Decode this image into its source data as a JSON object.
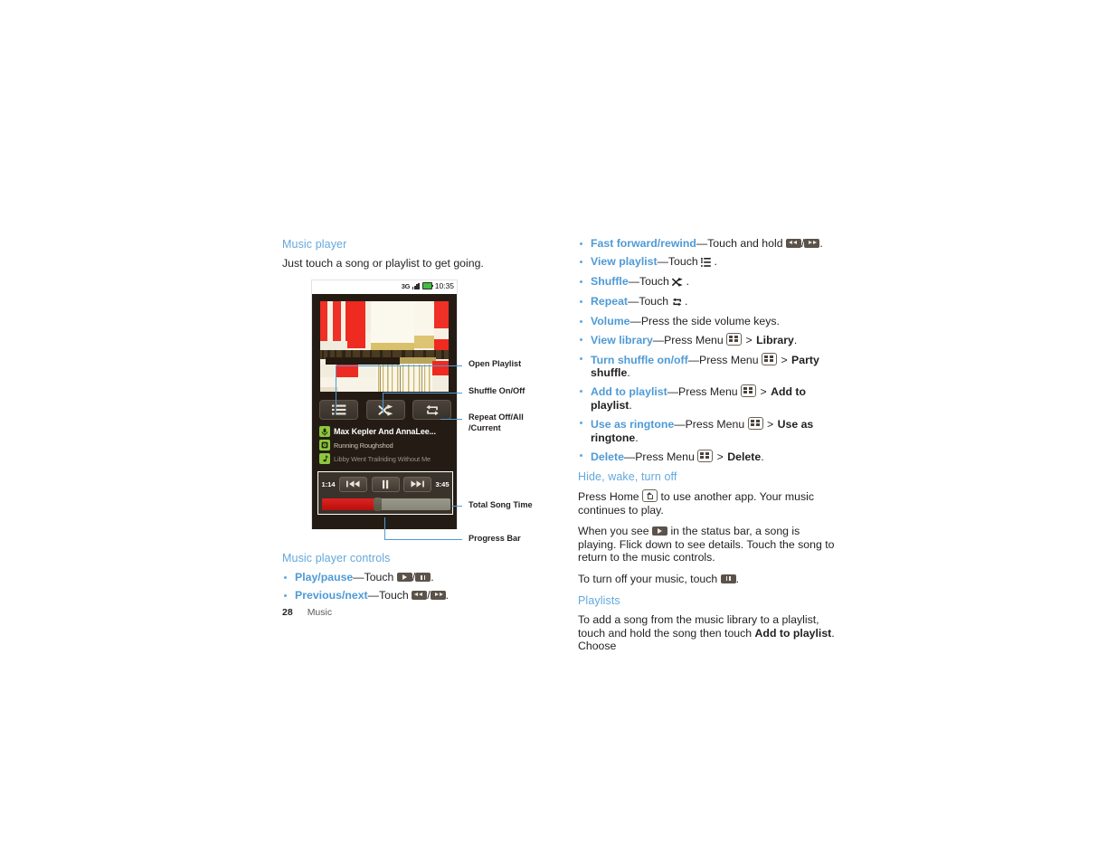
{
  "document": {
    "page_number": "28",
    "chapter": "Music"
  },
  "left_column": {
    "section_title": "Music player",
    "intro": "Just touch a song or playlist to get going.",
    "controls_title": "Music player controls",
    "controls": [
      {
        "term": "Play/pause",
        "dash": "—Touch ",
        "icons": [
          "play-button-icon",
          "pause-button-icon"
        ],
        "tail": "."
      },
      {
        "term": "Previous/next",
        "dash": "—Touch ",
        "icons": [
          "previous-button-icon",
          "next-button-icon"
        ],
        "tail": "."
      }
    ]
  },
  "callouts": [
    {
      "id": "open-playlist",
      "label": "Open Playlist"
    },
    {
      "id": "shuffle-on-off",
      "label": "Shuffle On/Off"
    },
    {
      "id": "repeat",
      "label_line1": "Repeat Off/All",
      "label_line2": "/Current"
    },
    {
      "id": "total-song-time",
      "label": "Total Song Time"
    },
    {
      "id": "progress-bar",
      "label": "Progress Bar"
    }
  ],
  "phone": {
    "status_bar": {
      "network": "3G",
      "time": "10:35",
      "signal_icon": "signal-bars-icon",
      "battery_icon": "battery-icon",
      "battery_color": "#3fbf3f"
    },
    "album_art": {
      "name": "album-art",
      "palette": [
        "#f4efdf",
        "#ee2d24",
        "#d8c36a",
        "#3a2f1e",
        "#ffffff"
      ]
    },
    "buttons": [
      {
        "id": "playlist",
        "icon": "playlist-icon"
      },
      {
        "id": "shuffle",
        "icon": "shuffle-icon"
      },
      {
        "id": "repeat",
        "icon": "repeat-icon"
      }
    ],
    "tracks": [
      {
        "title": "Max Kepler And AnnaLee...",
        "icon": "artist-mic-icon",
        "type": "artist"
      },
      {
        "title": "Running Roughshod",
        "icon": "album-disc-icon",
        "type": "album"
      },
      {
        "title": "Libby Went Trailriding Without  Me",
        "icon": "song-note-icon",
        "type": "song"
      }
    ],
    "player": {
      "elapsed": "1:14",
      "duration": "3:45",
      "prev_icon": "previous-icon",
      "pause_icon": "pause-icon",
      "next_icon": "next-icon",
      "progress_percent": 44
    }
  },
  "right_column": {
    "bullets": [
      {
        "term": "Fast forward/rewind",
        "parts": [
          {
            "t": "text",
            "v": "—Touch and hold "
          },
          {
            "t": "icon",
            "v": "rewind-button-icon"
          },
          {
            "t": "text",
            "v": "/"
          },
          {
            "t": "icon",
            "v": "fastforward-button-icon"
          },
          {
            "t": "text",
            "v": "."
          }
        ]
      },
      {
        "term": "View playlist",
        "parts": [
          {
            "t": "text",
            "v": "—Touch "
          },
          {
            "t": "icon",
            "v": "playlist-glyph-icon"
          },
          {
            "t": "text",
            "v": " ."
          }
        ]
      },
      {
        "term": "Shuffle",
        "parts": [
          {
            "t": "text",
            "v": "—Touch "
          },
          {
            "t": "icon",
            "v": "shuffle-glyph-icon"
          },
          {
            "t": "text",
            "v": " ."
          }
        ]
      },
      {
        "term": "Repeat",
        "parts": [
          {
            "t": "text",
            "v": "—Touch "
          },
          {
            "t": "icon",
            "v": "repeat-glyph-icon"
          },
          {
            "t": "text",
            "v": " ."
          }
        ]
      },
      {
        "term": "Volume",
        "parts": [
          {
            "t": "text",
            "v": "—Press the side volume keys."
          }
        ]
      },
      {
        "term": "View library",
        "parts": [
          {
            "t": "text",
            "v": "—Press Menu "
          },
          {
            "t": "icon",
            "v": "menu-key-icon"
          },
          {
            "t": "text",
            "v": " > "
          },
          {
            "t": "bold",
            "v": "Library"
          },
          {
            "t": "text",
            "v": "."
          }
        ]
      },
      {
        "term": "Turn shuffle on/off",
        "parts": [
          {
            "t": "text",
            "v": "—Press Menu "
          },
          {
            "t": "icon",
            "v": "menu-key-icon"
          },
          {
            "t": "text",
            "v": " > "
          },
          {
            "t": "bold",
            "v": "Party shuffle"
          },
          {
            "t": "text",
            "v": "."
          }
        ]
      },
      {
        "term": "Add to playlist",
        "parts": [
          {
            "t": "text",
            "v": "—Press Menu "
          },
          {
            "t": "icon",
            "v": "menu-key-icon"
          },
          {
            "t": "text",
            "v": " > "
          },
          {
            "t": "bold",
            "v": "Add to playlist"
          },
          {
            "t": "text",
            "v": "."
          }
        ]
      },
      {
        "term": "Use as ringtone",
        "parts": [
          {
            "t": "text",
            "v": "—Press Menu "
          },
          {
            "t": "icon",
            "v": "menu-key-icon"
          },
          {
            "t": "text",
            "v": " > "
          },
          {
            "t": "bold",
            "v": "Use as ringtone"
          },
          {
            "t": "text",
            "v": "."
          }
        ]
      },
      {
        "term": "Delete",
        "parts": [
          {
            "t": "text",
            "v": "—Press Menu "
          },
          {
            "t": "icon",
            "v": "menu-key-icon"
          },
          {
            "t": "text",
            "v": " > "
          },
          {
            "t": "bold",
            "v": "Delete"
          },
          {
            "t": "text",
            "v": "."
          }
        ]
      }
    ],
    "hide_section": {
      "title": "Hide, wake, turn off",
      "p1_a": "Press Home ",
      "p1_icon": "home-key-icon",
      "p1_b": " to use another app. Your music continues to play.",
      "p2_a": "When you see ",
      "p2_icon": "play-status-icon",
      "p2_b": " in the status bar, a song is playing. Flick down to see details. Touch the song to return to the music controls.",
      "p3_a": "To turn off your music, touch ",
      "p3_icon": "pause-button-icon",
      "p3_b": "."
    },
    "playlists_section": {
      "title": "Playlists",
      "p1_a": "To add a song from the music library to a playlist, touch and hold the song then touch ",
      "p1_bold": "Add to playlist",
      "p1_b": ". Choose"
    }
  },
  "colors": {
    "accent_blue": "#4e9ad6",
    "heading_blue": "#63a8dd",
    "body_black": "#231f20",
    "phone_bg": "#241c14",
    "progress_red": "#d3201d",
    "badge_green": "#8dc63f"
  }
}
